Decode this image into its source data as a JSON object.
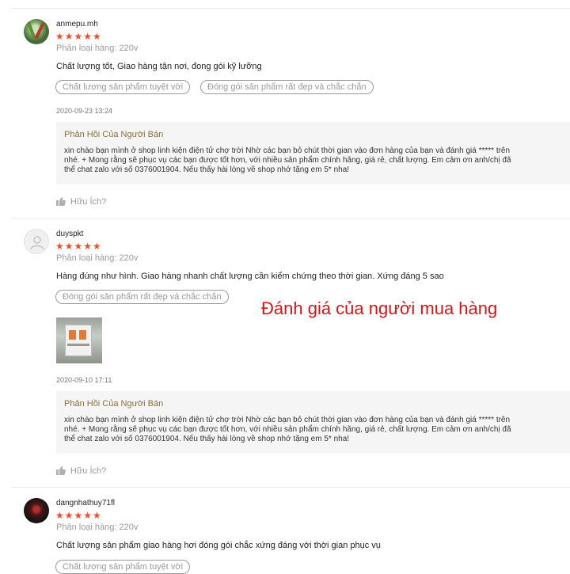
{
  "reviews": [
    {
      "username": "anmepu.mh",
      "stars": "★★★★★",
      "variation": "Phân loại hàng: 220v",
      "comment": "Chất lượng tốt, Giao hàng tận nơi, đong gói kỹ lưỡng",
      "tags": [
        "Chất lượng sản phẩm tuyệt vời",
        "Đóng gói sản phẩm rất đẹp và chắc chắn"
      ],
      "timestamp": "2020-09-23 13:24",
      "reply": {
        "title": "Phản Hồi Của Người Bán",
        "lines": [
          "xin chào bạn mình ở shop linh kiện điện tử chợ trời Nhờ các bạn bỏ chút thời gian vào đơn hàng của bạn và đánh giá ***** trên",
          "nhé. + Mong rằng sẽ phục vụ các bạn được tốt hơn, với nhiều sản phẩm chính hãng, giá rẻ, chất lượng. Em cảm ơn anh/chị đã",
          "thể chat zalo với số 0376001904. Nếu thấy hài lòng về shop nhớ tặng em 5* nha!"
        ]
      },
      "helpful": "Hữu Ích?"
    },
    {
      "username": "duyspkt",
      "stars": "★★★★★",
      "variation": "Phân loại hàng: 220v",
      "comment": "Hàng đúng như hình. Giao hàng nhanh chất lượng cần kiểm chứng theo thời gian. Xứng đáng 5 sao",
      "tags": [
        "Đóng gói sản phẩm rất đẹp và chắc chắn"
      ],
      "timestamp": "2020-09-10 17:11",
      "reply": {
        "title": "Phản Hồi Của Người Bán",
        "lines": [
          "xin chào bạn mình ở shop linh kiện điện tử chợ trời Nhờ các bạn bỏ chút thời gian vào đơn hàng của bạn và đánh giá ***** trên",
          "nhé. + Mong rằng sẽ phục vụ các bạn được tốt hơn, với nhiều sản phẩm chính hãng, giá rẻ, chất lượng. Em cảm ơn anh/chị đã",
          "thể chat zalo với số 0376001904. Nếu thấy hài lòng về shop nhớ tặng em 5* nha!"
        ]
      },
      "helpful": "Hữu Ích?"
    },
    {
      "username": "dangnhathuy71fl",
      "stars": "★★★★★",
      "variation": "Phân loại hàng: 220v",
      "comment": "Chất lượng sản phẩm giao hàng hơi đóng gói chắc xứng đáng với thời gian phục vụ",
      "tags": [
        "Chất lượng sản phẩm tuyệt vời"
      ]
    }
  ],
  "overlay_title": "Đánh giá của người mua hàng",
  "colors": {
    "star": "#ee4d2d",
    "reply_title": "#8a6d3b",
    "overlay": "#d4141a"
  }
}
